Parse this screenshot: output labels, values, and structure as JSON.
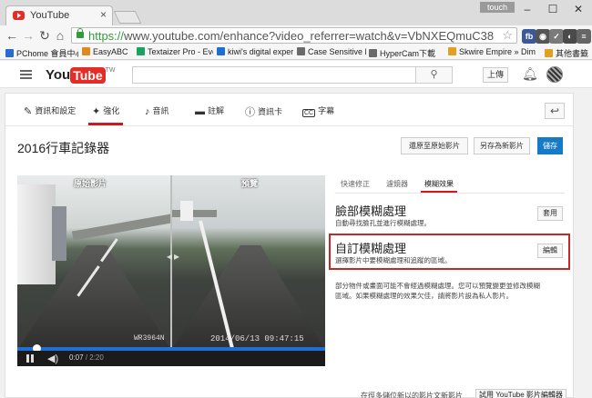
{
  "browser": {
    "tab_title": "YouTube",
    "tab_close": "×",
    "badge": "touch",
    "window_controls": [
      "–",
      "☐",
      "✕"
    ],
    "url_scheme": "https://",
    "url_rest": "www.youtube.com/enhance?video_referrer=watch&v=VbNXEQmuC38",
    "extensions": [
      {
        "label": "fb",
        "color": "#3b5998"
      },
      {
        "label": "◉",
        "color": "#555555"
      },
      {
        "label": "✓",
        "color": "#7a7a7a"
      },
      {
        "label": "◐",
        "color": "#4a4a4a"
      },
      {
        "label": "≡",
        "color": "#666666"
      }
    ],
    "bookmarks": [
      {
        "label": "PChome 會員中心",
        "color": "#2a6bd1"
      },
      {
        "label": "EasyABC",
        "color": "#e08a1e"
      },
      {
        "label": "Textaizer Pro - Every",
        "color": "#1aa260"
      },
      {
        "label": "kiwi's digital exper",
        "color": "#1f6fd0"
      },
      {
        "label": "Case Sensitive Find",
        "color": "#6a6a6a"
      },
      {
        "label": "HyperCam下載",
        "color": "#6a6a6a"
      },
      {
        "label": "Skwire Empire » Dim",
        "color": "#e0a020"
      },
      {
        "label": "其他書籤",
        "color": "#e0a020"
      }
    ]
  },
  "youtube": {
    "logo_you": "You",
    "logo_tube": "Tube",
    "logo_tw": "TW",
    "upload_label": "上傳"
  },
  "editor": {
    "nav_tabs": [
      {
        "label": "資訊和設定",
        "icon": "✎"
      },
      {
        "label": "強化",
        "icon": "✦"
      },
      {
        "label": "音訊",
        "icon": "♪"
      },
      {
        "label": "註解",
        "icon": "▬"
      },
      {
        "label": "資訊卡",
        "icon": "ⓘ"
      },
      {
        "label": "字幕",
        "icon": "CC"
      }
    ],
    "undo_label": "↩",
    "video_title": "2016行車記錄器",
    "buttons": {
      "revert": "還原至原始影片",
      "save_as_new": "另存為新影片",
      "save": "儲存"
    },
    "player": {
      "left_label": "原始影片",
      "right_label": "預覽",
      "plate_text": "WR3964N",
      "timestamp": "2014/06/13 09:47:15",
      "current_time": "0:07",
      "duration": "/ 2:20",
      "progress": 0.05
    },
    "sub_tabs": [
      "快速修正",
      "濾鏡器",
      "模糊效果"
    ],
    "face_blur": {
      "title": "臉部模糊處理",
      "desc": "自動尋找臉孔並進行模糊處理。",
      "button": "套用"
    },
    "custom_blur": {
      "title": "自訂模糊處理",
      "desc": "選擇影片中要模糊處理和追蹤的區域。",
      "button": "編輯"
    },
    "note": "部分物件或畫面可能不會經過模糊處理。您可以預覽變更並修改模糊區域。如果模糊處理的效果欠佳，請將影片設為私人影片。",
    "footer_text": "在徑多儲位新以的影片文新影片",
    "footer_button": "試用 YouTube 影片編輯器"
  }
}
